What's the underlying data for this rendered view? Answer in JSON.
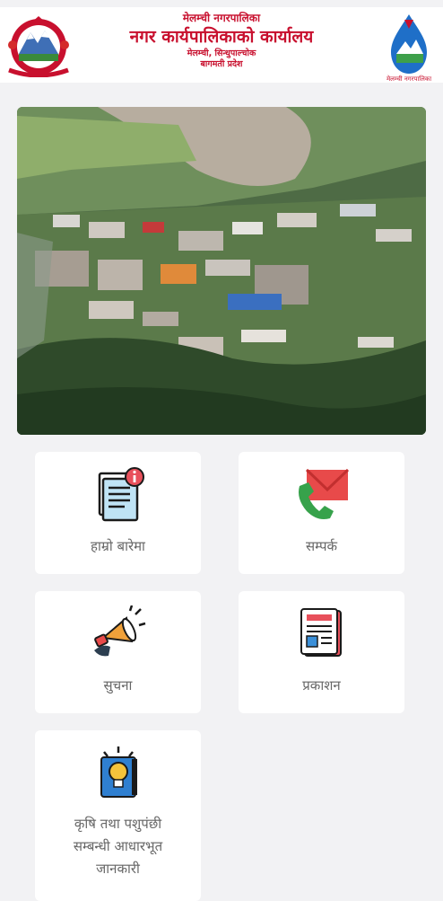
{
  "header": {
    "line1": "मेलम्ची नगरपालिका",
    "line2": "नगर कार्यपालिकाको कार्यालय",
    "line3": "मेलम्ची, सिन्धुपाल्चोक",
    "line4": "बागमती प्रदेश",
    "logo_caption": "मेलम्ची नगरपालिका"
  },
  "hero": {
    "alt": "town-landscape-photo"
  },
  "cards": [
    {
      "label": "हाम्रो बारेमा",
      "icon": "about-document-icon"
    },
    {
      "label": "सम्पर्क",
      "icon": "phone-mail-icon"
    },
    {
      "label": "सुचना",
      "icon": "megaphone-icon"
    },
    {
      "label": "प्रकाशन",
      "icon": "newspaper-icon"
    },
    {
      "label": "कृषि तथा पशुपंछी सम्बन्धी आधारभूत जानकारी",
      "icon": "lightbulb-book-icon"
    }
  ],
  "colors": {
    "brand_red": "#c8102e",
    "background": "#f2f2f4"
  }
}
